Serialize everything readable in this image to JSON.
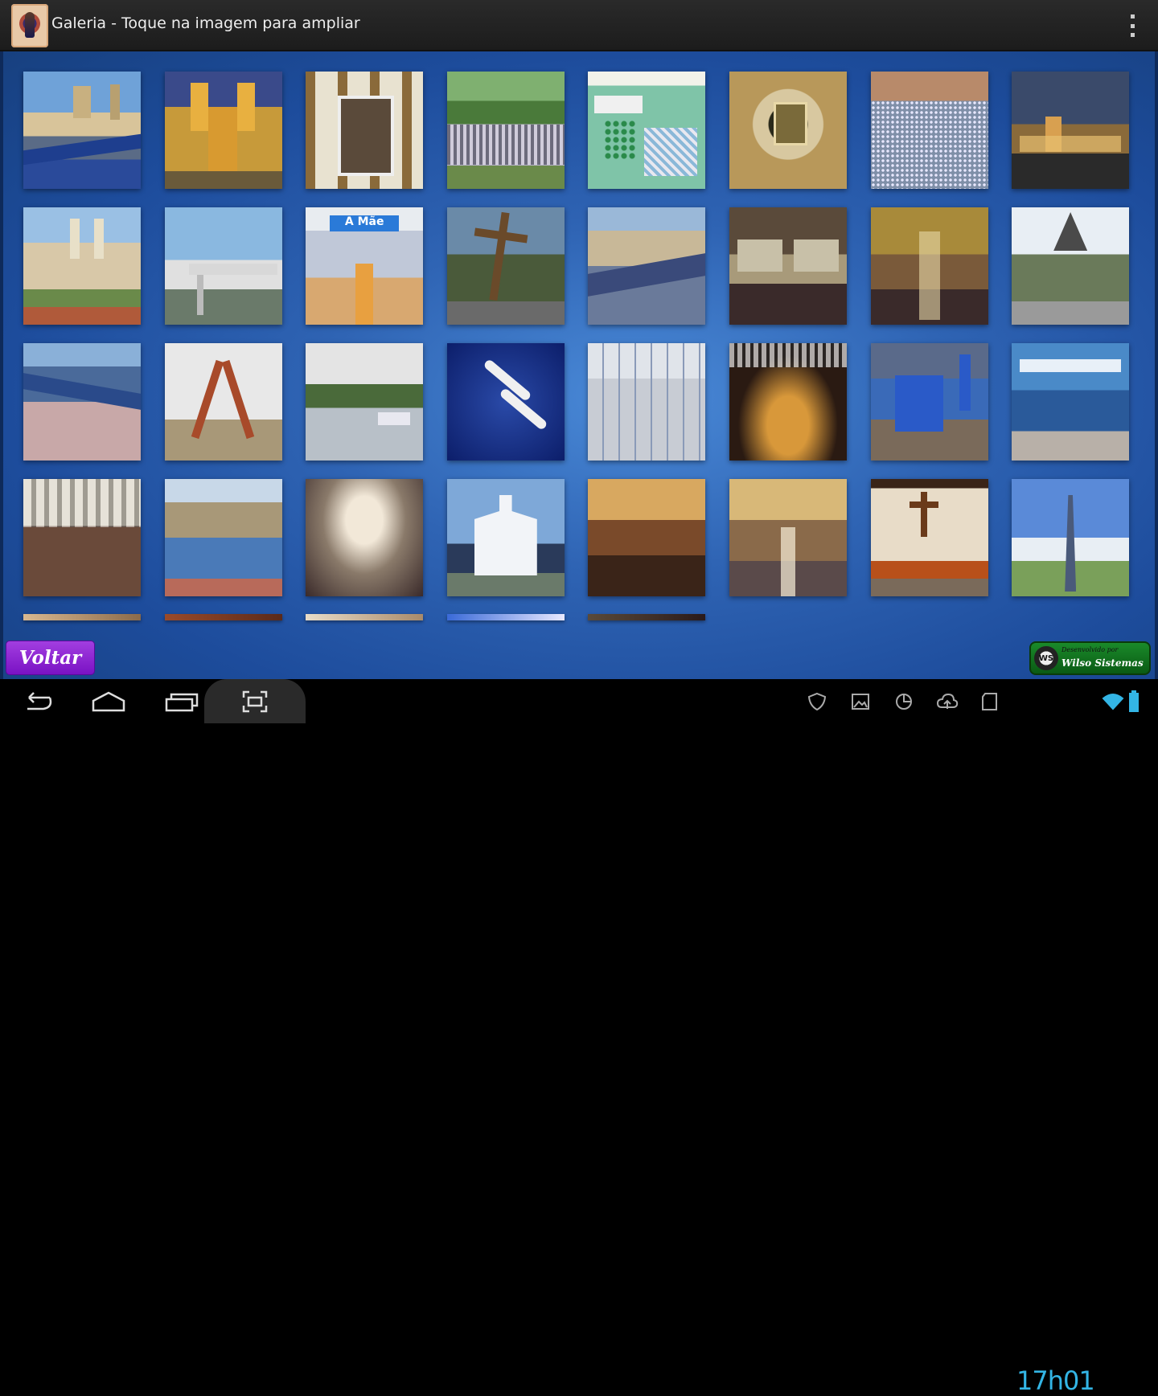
{
  "app": {
    "title": "Galeria - Toque na imagem para ampliar",
    "icon": "sanctuary-app-icon",
    "overflow_icon": "overflow-menu-icon"
  },
  "gallery": {
    "thumbnails": [
      "Basílica e passarela",
      "Igreja iluminada à noite",
      "Interior com elevadores",
      "Multidão no jardim",
      "Mapa do santuário",
      "Nicho da imagem",
      "Multidão na praça",
      "Santuário ao anoitecer",
      "Igreja com duas torres",
      "Entrada com bandeiras",
      "Corredor A Mãe",
      "Cruz no jardim",
      "Vista aérea com passarela",
      "Sala de exposição",
      "Nave da basílica",
      "Jardim com fonte",
      "Passarela com fiéis",
      "Monumento de ferro",
      "Rio e arvoredo",
      "Pombas no céu",
      "Galeria comercial",
      "Velas acesas",
      "Maquete de igreja",
      "Loja de lembranças",
      "Sala de velas",
      "Vista aérea da cidade",
      "Interior de capela",
      "Igreja azul e branca",
      "Missa na basílica",
      "Nave principal",
      "Altar com crucifixo",
      "Torre ao céu"
    ]
  },
  "footer": {
    "back_label": "Voltar",
    "brand_tagline": "Desenvolvido por",
    "brand_name": "Wilso Sistemas",
    "brand_logo_text": "WS"
  },
  "system_bar": {
    "clock": "17h01",
    "nav_icons": [
      "back-icon",
      "home-icon",
      "recent-apps-icon",
      "screenshot-icon"
    ],
    "status_icons": [
      "shield-icon",
      "image-icon",
      "sync-icon",
      "cloud-upload-icon",
      "sd-card-icon",
      "wifi-icon",
      "battery-icon"
    ],
    "accent_color": "#33b5e5"
  },
  "colors": {
    "background_blue": "#2f64b4",
    "back_button": "#8a20d0",
    "brand_green": "#1a8a2a"
  }
}
